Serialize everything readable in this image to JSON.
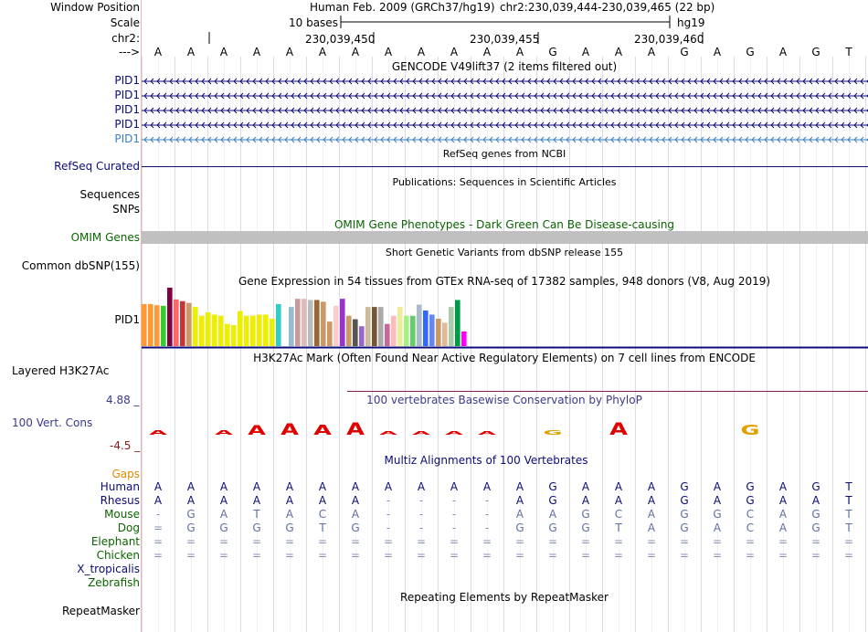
{
  "header": {
    "labels": {
      "window_position": "Window Position",
      "scale": "Scale",
      "chrom": "chr2:",
      "arrow": "--->"
    },
    "assembly_title": "Human Feb. 2009 (GRCh37/hg19)",
    "position": "chr2:230,039,444-230,039,465 (22 bp)",
    "scale_text": "10 bases",
    "assembly_short": "hg19",
    "coords": [
      "230,039,450",
      "230,039,455",
      "230,039,460"
    ],
    "bases": [
      "A",
      "A",
      "A",
      "A",
      "A",
      "A",
      "A",
      "A",
      "A",
      "A",
      "A",
      "A",
      "G",
      "A",
      "A",
      "A",
      "G",
      "A",
      "G",
      "A",
      "G",
      "T"
    ]
  },
  "tracks": {
    "gencode": {
      "title": "GENCODE V49lift37 (2 items filtered out)",
      "rows": [
        "PID1",
        "PID1",
        "PID1",
        "PID1",
        "PID1"
      ],
      "row_colors": [
        "#0c0c78",
        "#0c0c78",
        "#0c0c78",
        "#0c0c78",
        "#3a7fc0"
      ]
    },
    "refseq": {
      "title": "RefSeq genes from NCBI",
      "label": "RefSeq Curated",
      "color": "#0c0c78"
    },
    "publications": {
      "title": "Publications: Sequences in Scientific Articles",
      "labels": [
        "Sequences",
        "SNPs"
      ]
    },
    "omim": {
      "title": "OMIM Gene Phenotypes - Dark Green Can Be Disease-causing",
      "label": "OMIM Genes",
      "color": "#0a6400"
    },
    "dbsnp": {
      "title": "Short Genetic Variants from dbSNP release 155",
      "label": "Common dbSNP(155)"
    },
    "gtex": {
      "title": "Gene Expression in 54 tissues from GTEx RNA-seq of 17382 samples, 948 donors (V8, Aug 2019)",
      "label": "PID1",
      "bar_heights": [
        0.72,
        0.72,
        0.7,
        0.69,
        1.0,
        0.8,
        0.77,
        0.74,
        0.67,
        0.52,
        0.58,
        0.54,
        0.52,
        0.38,
        0.36,
        0.6,
        0.52,
        0.52,
        0.54,
        0.54,
        0.47,
        0.72,
        0.0,
        0.67,
        0.81,
        0.81,
        0.79,
        0.79,
        0.76,
        0.42,
        0.69,
        0.81,
        0.52,
        0.46,
        0.34,
        0.67,
        0.67,
        0.67,
        0.38,
        0.52,
        0.67,
        0.52,
        0.52,
        0.71,
        0.61,
        0.54,
        0.47,
        0.4,
        0.67,
        0.79,
        0.25
      ],
      "bar_colors": [
        "#ff9933",
        "#ff9933",
        "#ff9933",
        "#33cc33",
        "#800040",
        "#ff6666",
        "#cc3333",
        "#cc9966",
        "#eeee00",
        "#eeee00",
        "#eeee00",
        "#eeee00",
        "#eeee00",
        "#eeee00",
        "#eeee00",
        "#eeee00",
        "#eeee00",
        "#eeee00",
        "#eeee00",
        "#eeee00",
        "#eeee00",
        "#33cccc",
        "#ffffff",
        "#99bbcc",
        "#cc9999",
        "#ddbbbb",
        "#bbbbbb",
        "#996633",
        "#cc9966",
        "#cc9966",
        "#ffcccc",
        "#9933cc",
        "#cc9966",
        "#555555",
        "#9966cc",
        "#ccbb99",
        "#775533",
        "#aaaaaa",
        "#cc6699",
        "#ffbbbb",
        "#eeee99",
        "#aaee88",
        "#66cc66",
        "#aabbcc",
        "#3366ff",
        "#6688ee",
        "#cc9966",
        "#ddbb99",
        "#aaccaa",
        "#009944",
        "#ff00ff"
      ]
    },
    "h3k27ac": {
      "title": "H3K27Ac Mark (Often Found Near Active Regulatory Elements) on 7 cell lines from ENCODE",
      "label": "Layered H3K27Ac"
    },
    "conservation": {
      "title": "100 vertebrates Basewise Conservation by PhyloP",
      "label": "100 Vert. Cons",
      "ymax": "4.88 _",
      "ymin": "-4.5 _",
      "scores": [
        0.3,
        0,
        0.3,
        0.7,
        0.9,
        0.8,
        1.0,
        0.15,
        0.15,
        0.15,
        0.15,
        0,
        0.3,
        0,
        1.0,
        0,
        0,
        0,
        0.8,
        0,
        0,
        0
      ]
    },
    "multiz": {
      "title": "Multiz Alignments of 100 Vertebrates",
      "gaps_label": "Gaps",
      "species": [
        {
          "name": "Human",
          "color": "#0c0c78",
          "seq": [
            "A",
            "A",
            "A",
            "A",
            "A",
            "A",
            "A",
            "A",
            "A",
            "A",
            "A",
            "A",
            "G",
            "A",
            "A",
            "A",
            "G",
            "A",
            "G",
            "A",
            "G",
            "T"
          ]
        },
        {
          "name": "Rhesus",
          "color": "#0c0c78",
          "seq": [
            "A",
            "A",
            "A",
            "A",
            "A",
            "A",
            "A",
            "-",
            "-",
            "-",
            "-",
            "A",
            "G",
            "A",
            "A",
            "A",
            "G",
            "A",
            "G",
            "A",
            "A",
            "T"
          ]
        },
        {
          "name": "Mouse",
          "color": "#0a6400",
          "seq": [
            "-",
            "G",
            "A",
            "T",
            "A",
            "C",
            "A",
            "-",
            "-",
            "-",
            "-",
            "A",
            "A",
            "G",
            "C",
            "A",
            "G",
            "G",
            "C",
            "A",
            "G",
            "T"
          ]
        },
        {
          "name": "Dog",
          "color": "#0a6400",
          "seq": [
            "=",
            "G",
            "G",
            "G",
            "G",
            "T",
            "G",
            "-",
            "-",
            "-",
            "-",
            "G",
            "G",
            "G",
            "T",
            "A",
            "G",
            "A",
            "C",
            "A",
            "G",
            "T"
          ]
        },
        {
          "name": "Elephant",
          "color": "#0a6400",
          "seq": [
            "=",
            "=",
            "=",
            "=",
            "=",
            "=",
            "=",
            "=",
            "=",
            "=",
            "=",
            "=",
            "=",
            "=",
            "=",
            "=",
            "=",
            "=",
            "=",
            "=",
            "=",
            "="
          ]
        },
        {
          "name": "Chicken",
          "color": "#0a6400",
          "seq": [
            "=",
            "=",
            "=",
            "=",
            "=",
            "=",
            "=",
            "=",
            "=",
            "=",
            "=",
            "=",
            "=",
            "=",
            "=",
            "=",
            "=",
            "=",
            "=",
            "=",
            "=",
            "="
          ]
        },
        {
          "name": "X_tropicalis",
          "color": "#0c0c78",
          "seq": []
        },
        {
          "name": "Zebrafish",
          "color": "#0a6400",
          "seq": []
        }
      ]
    },
    "repeatmasker": {
      "title": "Repeating Elements by RepeatMasker",
      "label": "RepeatMasker"
    }
  }
}
